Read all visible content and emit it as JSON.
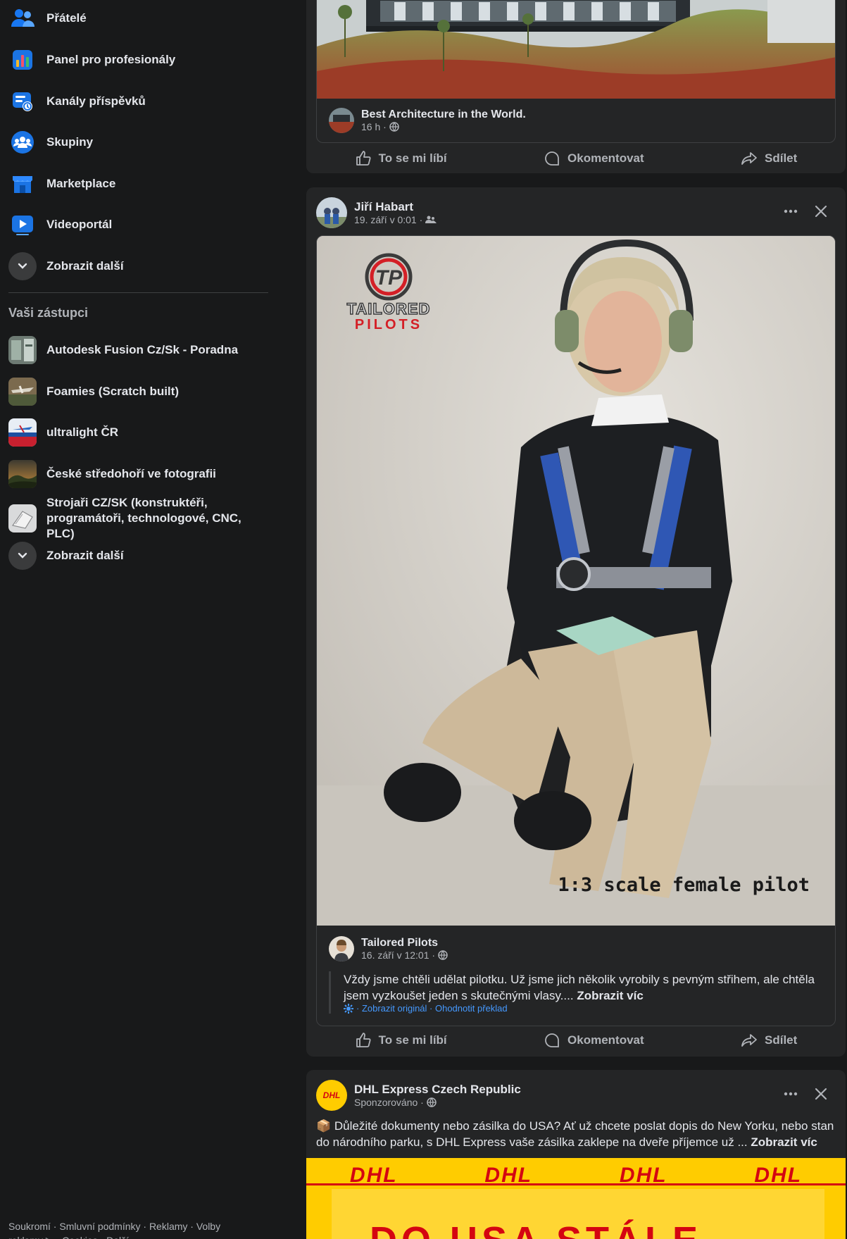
{
  "sidebar": {
    "nav": [
      {
        "label": "Přátelé",
        "icon": "friends-icon"
      },
      {
        "label": "Panel pro profesionály",
        "icon": "professional-dashboard-icon"
      },
      {
        "label": "Kanály příspěvků",
        "icon": "feeds-icon"
      },
      {
        "label": "Skupiny",
        "icon": "groups-icon"
      },
      {
        "label": "Marketplace",
        "icon": "marketplace-icon"
      },
      {
        "label": "Videoportál",
        "icon": "video-icon"
      }
    ],
    "show_more_1": "Zobrazit další",
    "shortcuts_title": "Vaši zástupci",
    "shortcuts": [
      {
        "label": "Autodesk Fusion Cz/Sk - Poradna"
      },
      {
        "label": "Foamies (Scratch built)"
      },
      {
        "label": "ultralight ČR"
      },
      {
        "label": "České středohoří ve fotografii"
      },
      {
        "label": "Strojaři CZ/SK (konstruktéři, programátoři, technologové, CNC, PLC)"
      }
    ],
    "show_more_2": "Zobrazit další",
    "footer": "Soukromí · Smluvní podmínky · Reklamy · Volby reklamy ▷ · Cookies · Další"
  },
  "post1": {
    "shared_page": "Best Architecture in the World.",
    "shared_time": "16 h ·"
  },
  "actions": {
    "like": "To se mi líbí",
    "comment": "Okomentovat",
    "share": "Sdílet"
  },
  "post2": {
    "author": "Jiří Habart",
    "time": "19. září v 0:01 ·",
    "image_caption": "1:3 scale female pilot",
    "logo_line1": "TAILORED",
    "logo_line2": "PILOTS",
    "logo_mark": "TP",
    "shared_page": "Tailored Pilots",
    "shared_time": "16. září v 12:01 ·",
    "text": "Vždy jsme chtěli udělat pilotku. Už jsme jich několik vyrobily s pevným střihem, ale chtěla jsem vyzkoušet jeden s skutečnými vlasy....",
    "see_more": "Zobrazit víc",
    "translation_links": "· Zobrazit originál · Ohodnotit překlad"
  },
  "post3": {
    "author": "DHL Express Czech Republic",
    "sponsored": "Sponzorováno ·",
    "text": "📦 Důležité dokumenty nebo zásilka do USA? Ať už chcete poslat dopis do New Yorku, nebo stan do národního parku, s DHL Express vaše zásilka zaklepe na dveře příjemce už ...",
    "see_more": "Zobrazit víc",
    "banner_logo": "DHL",
    "avatar_logo": "DHL",
    "banner_headline": "DO USA STÁLE"
  },
  "colors": {
    "bg": "#18191a",
    "card": "#242526",
    "text": "#e4e6eb",
    "muted": "#b0b3b8",
    "dhl_yellow": "#ffcc00",
    "dhl_red": "#d40511",
    "link": "#4599ff"
  }
}
